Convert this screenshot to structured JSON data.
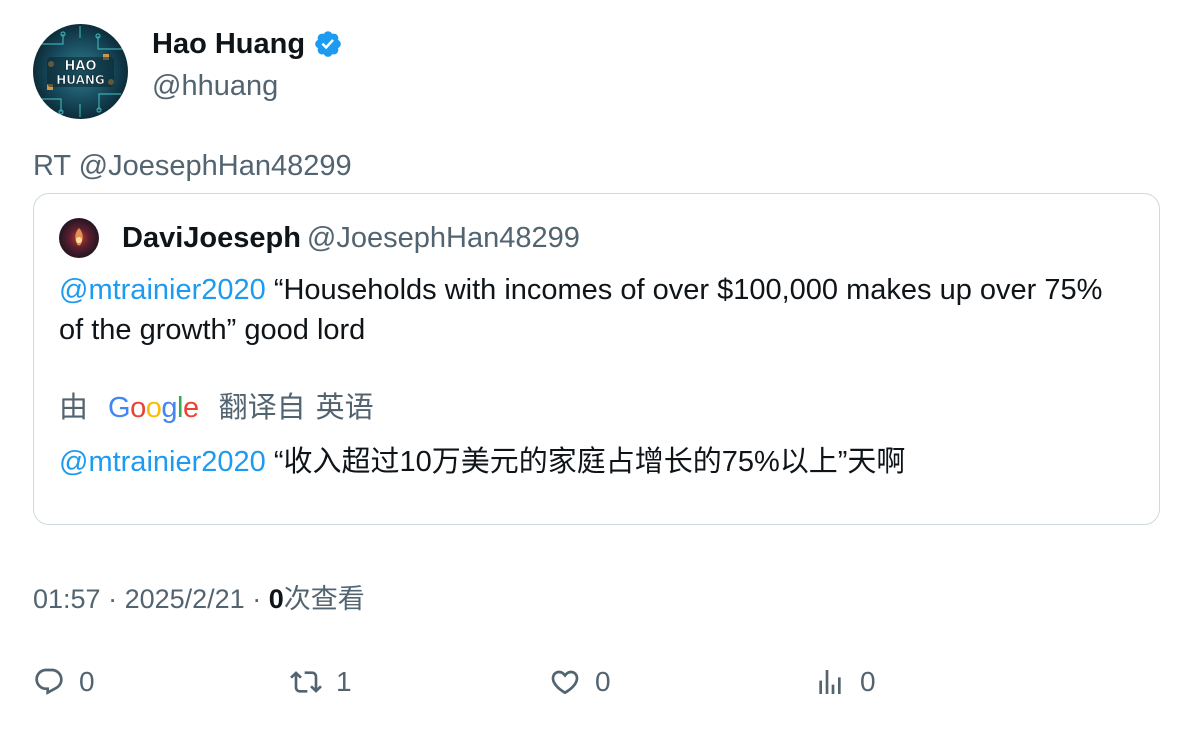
{
  "author": {
    "name": "Hao Huang",
    "handle": "@hhuang",
    "avatar_text": "HAO HUANG",
    "verified": true
  },
  "retweet_line": "RT @JoesephHan48299",
  "quote": {
    "name": "DaviJoeseph",
    "handle": "@JoesephHan48299",
    "mention": "@mtrainier2020",
    "text": " “Households with incomes of over $100,000 makes up over 75% of the growth” good lord",
    "translate": {
      "by": "由",
      "provider": "Google",
      "from_label": "翻译自",
      "language": "英语"
    },
    "translated_mention": "@mtrainier2020",
    "translated_text": " “收入超过10万美元的家庭占增长的75%以上”天啊"
  },
  "meta": {
    "time": "01:57",
    "separator": " · ",
    "date": "2025/2/21",
    "separator2": " · ",
    "views_count": "0",
    "views_label": "次查看"
  },
  "actions": {
    "reply_count": "0",
    "retweet_count": "1",
    "like_count": "0",
    "views_count": "0"
  },
  "colors": {
    "accent": "#1d9bf0",
    "secondary_text": "#536471",
    "border": "#cfd9de"
  }
}
